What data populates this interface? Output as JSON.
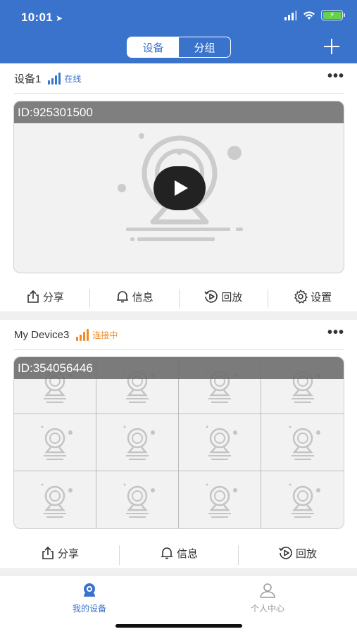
{
  "status_bar": {
    "time": "10:01",
    "location_arrow": "➤"
  },
  "header": {
    "segments": [
      {
        "label": "设备",
        "active": true
      },
      {
        "label": "分组",
        "active": false
      }
    ],
    "add_icon": "plus-icon"
  },
  "devices": [
    {
      "name": "设备1",
      "status": "在线",
      "status_color": "#3a73cc",
      "id_text": "ID:925301500",
      "actions": [
        "分享",
        "信息",
        "回放",
        "设置"
      ]
    },
    {
      "name": "My Device3",
      "status": "连接中",
      "status_color": "#f08a24",
      "id_text": "ID:354056446",
      "actions": [
        "分享",
        "信息",
        "回放"
      ]
    }
  ],
  "tabbar": {
    "tabs": [
      {
        "label": "我的设备",
        "active": true,
        "icon": "camera-icon"
      },
      {
        "label": "个人中心",
        "active": false,
        "icon": "person-icon"
      }
    ]
  },
  "colors": {
    "primary": "#3a73cc",
    "online": "#3a73cc",
    "connecting": "#f08a24"
  }
}
